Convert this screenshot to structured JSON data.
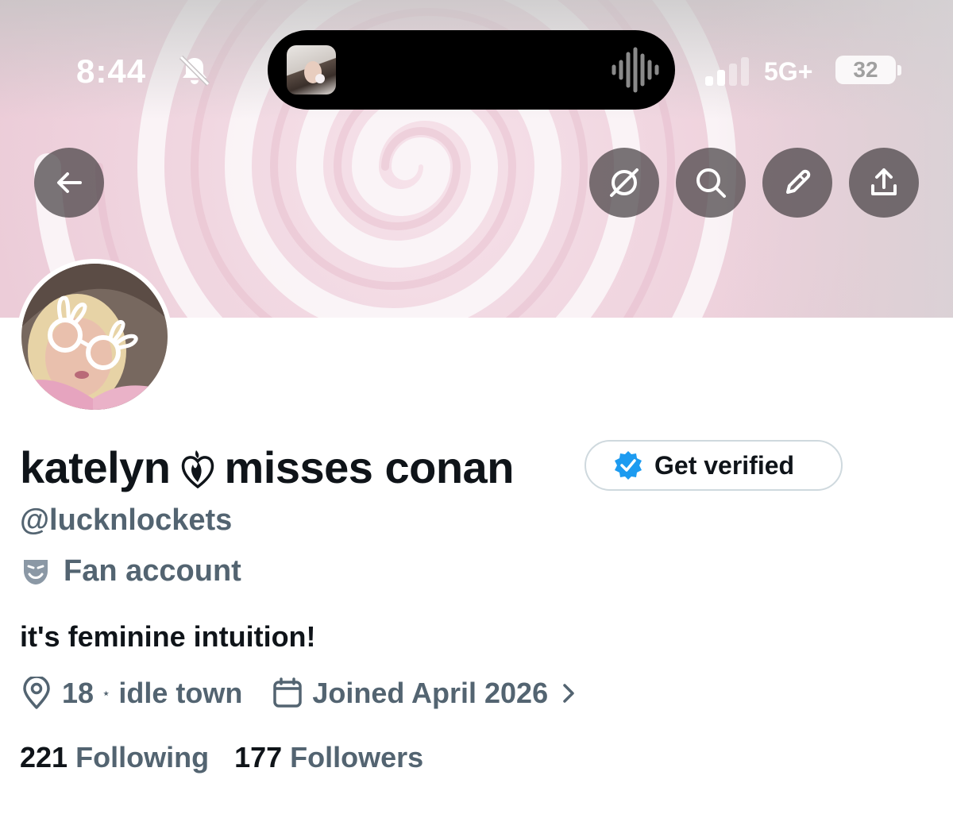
{
  "status_bar": {
    "time": "8:44",
    "network": "5G+",
    "battery": "32"
  },
  "profile": {
    "display_name_part1": "katelyn",
    "display_name_part2": "misses conan",
    "verify_button_label": "Get verified",
    "handle": "@lucknlockets",
    "category": "Fan account",
    "bio": "it's feminine intuition!",
    "location": "18",
    "location_detail": "idle town",
    "joined": "Joined April 2026",
    "following_count": "221",
    "following_label": "Following",
    "followers_count": "177",
    "followers_label": "Followers"
  },
  "colors": {
    "primary_text": "#0f1419",
    "secondary_text": "#536471",
    "verified_blue": "#1d9bf0",
    "banner_pink": "#f1d1dd"
  },
  "icons": {
    "back": "arrow-left-icon",
    "grok": "grok-icon",
    "search": "search-icon",
    "edit": "pencil-icon",
    "share": "share-icon",
    "location": "location-pin-icon",
    "calendar": "calendar-icon",
    "category": "theater-mask-icon"
  }
}
